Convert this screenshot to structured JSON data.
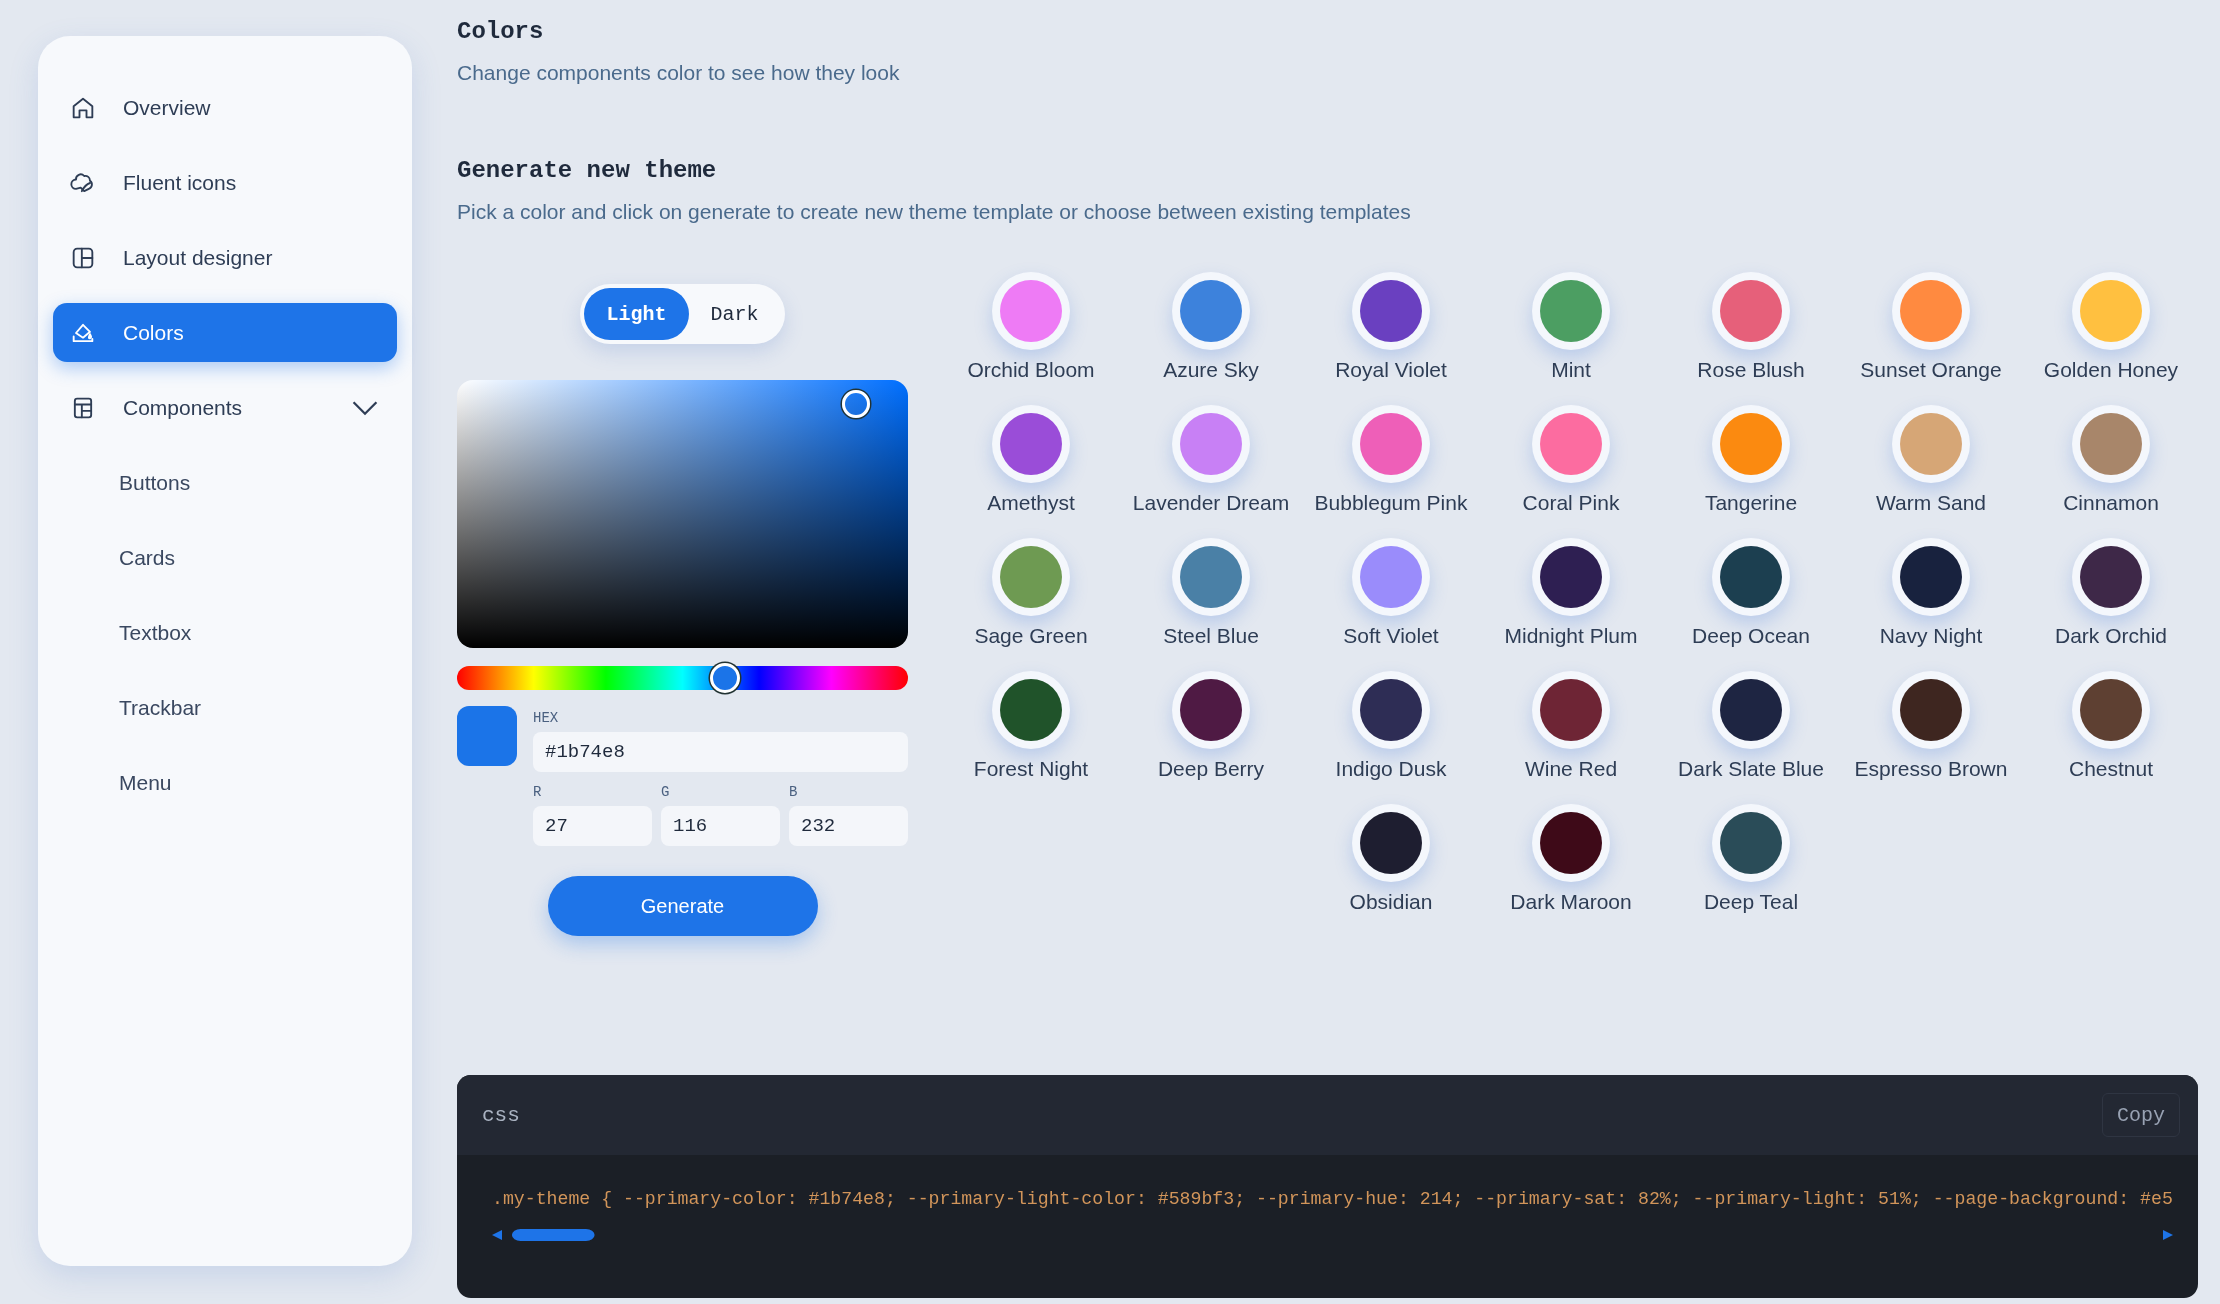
{
  "sidebar": {
    "items": [
      {
        "label": "Overview",
        "kind": "home",
        "selected": false
      },
      {
        "label": "Fluent icons",
        "kind": "fluent",
        "selected": false
      },
      {
        "label": "Layout designer",
        "kind": "layout",
        "selected": false
      },
      {
        "label": "Colors",
        "kind": "bucket",
        "selected": true
      },
      {
        "label": "Components",
        "kind": "table",
        "selected": false,
        "expanded": true,
        "children": [
          {
            "label": "Buttons",
            "selected": false
          },
          {
            "label": "Cards",
            "selected": false
          },
          {
            "label": "Textbox",
            "selected": false
          },
          {
            "label": "Trackbar",
            "selected": false
          },
          {
            "label": "Menu",
            "selected": false
          }
        ]
      }
    ]
  },
  "header": {
    "title": "Colors",
    "subtitle": "Change components color to see how they look"
  },
  "generator": {
    "title": "Generate new theme",
    "subtitle": "Pick a color and click on generate to create new theme template or choose between existing templates",
    "mode_tabs": [
      {
        "label": "Light",
        "selected": true
      },
      {
        "label": "Dark",
        "selected": false
      }
    ],
    "picker": {
      "hue_slider": {
        "level": 0.594
      },
      "hex_label": "HEX",
      "hex": "#1b74e8",
      "channels": [
        {
          "label": "R",
          "value": "27"
        },
        {
          "label": "G",
          "value": "116"
        },
        {
          "label": "B",
          "value": "232"
        }
      ]
    },
    "generate_button": "Generate"
  },
  "swatches": [
    {
      "name": "Orchid Bloom",
      "color": "#ee7bf5"
    },
    {
      "name": "Azure Sky",
      "color": "#3d82dc"
    },
    {
      "name": "Royal Violet",
      "color": "#6a40c0"
    },
    {
      "name": "Mint",
      "color": "#4c9e62"
    },
    {
      "name": "Rose Blush",
      "color": "#e6607a"
    },
    {
      "name": "Sunset Orange",
      "color": "#ff8a40"
    },
    {
      "name": "Golden Honey",
      "color": "#ffc040"
    },
    {
      "name": "Amethyst",
      "color": "#9a4dd8"
    },
    {
      "name": "Lavender Dream",
      "color": "#c880f5"
    },
    {
      "name": "Bubblegum Pink",
      "color": "#ee5fb8"
    },
    {
      "name": "Coral Pink",
      "color": "#fc6ca0"
    },
    {
      "name": "Tangerine",
      "color": "#fb8a10"
    },
    {
      "name": "Warm Sand",
      "color": "#d6a676"
    },
    {
      "name": "Cinnamon",
      "color": "#a8866a"
    },
    {
      "name": "Sage Green",
      "color": "#6e9a52"
    },
    {
      "name": "Steel Blue",
      "color": "#4a80a6"
    },
    {
      "name": "Soft Violet",
      "color": "#9a8cfb"
    },
    {
      "name": "Midnight Plum",
      "color": "#2e1f52"
    },
    {
      "name": "Deep Ocean",
      "color": "#1c3f50"
    },
    {
      "name": "Navy Night",
      "color": "#18223e"
    },
    {
      "name": "Dark Orchid",
      "color": "#3e2848"
    },
    {
      "name": "Forest Night",
      "color": "#20532a"
    },
    {
      "name": "Deep Berry",
      "color": "#4f1a44"
    },
    {
      "name": "Indigo Dusk",
      "color": "#2e2d55"
    },
    {
      "name": "Wine Red",
      "color": "#6e2535"
    },
    {
      "name": "Dark Slate Blue",
      "color": "#1e2542"
    },
    {
      "name": "Espresso Brown",
      "color": "#3e2620"
    },
    {
      "name": "Chestnut",
      "color": "#5e4032"
    },
    {
      "name": "Obsidian",
      "color": "#1e1e30"
    },
    {
      "name": "Dark Maroon",
      "color": "#3e0a18"
    },
    {
      "name": "Deep Teal",
      "color": "#2a4c58"
    }
  ],
  "code": {
    "language": "css",
    "copy_button": "Copy",
    "text": ".my-theme { --primary-color: #1b74e8; --primary-light-color: #589bf3; --primary-hue: 214; --primary-sat: 82%; --primary-light: 51%; --page-background: #e5"
  }
}
